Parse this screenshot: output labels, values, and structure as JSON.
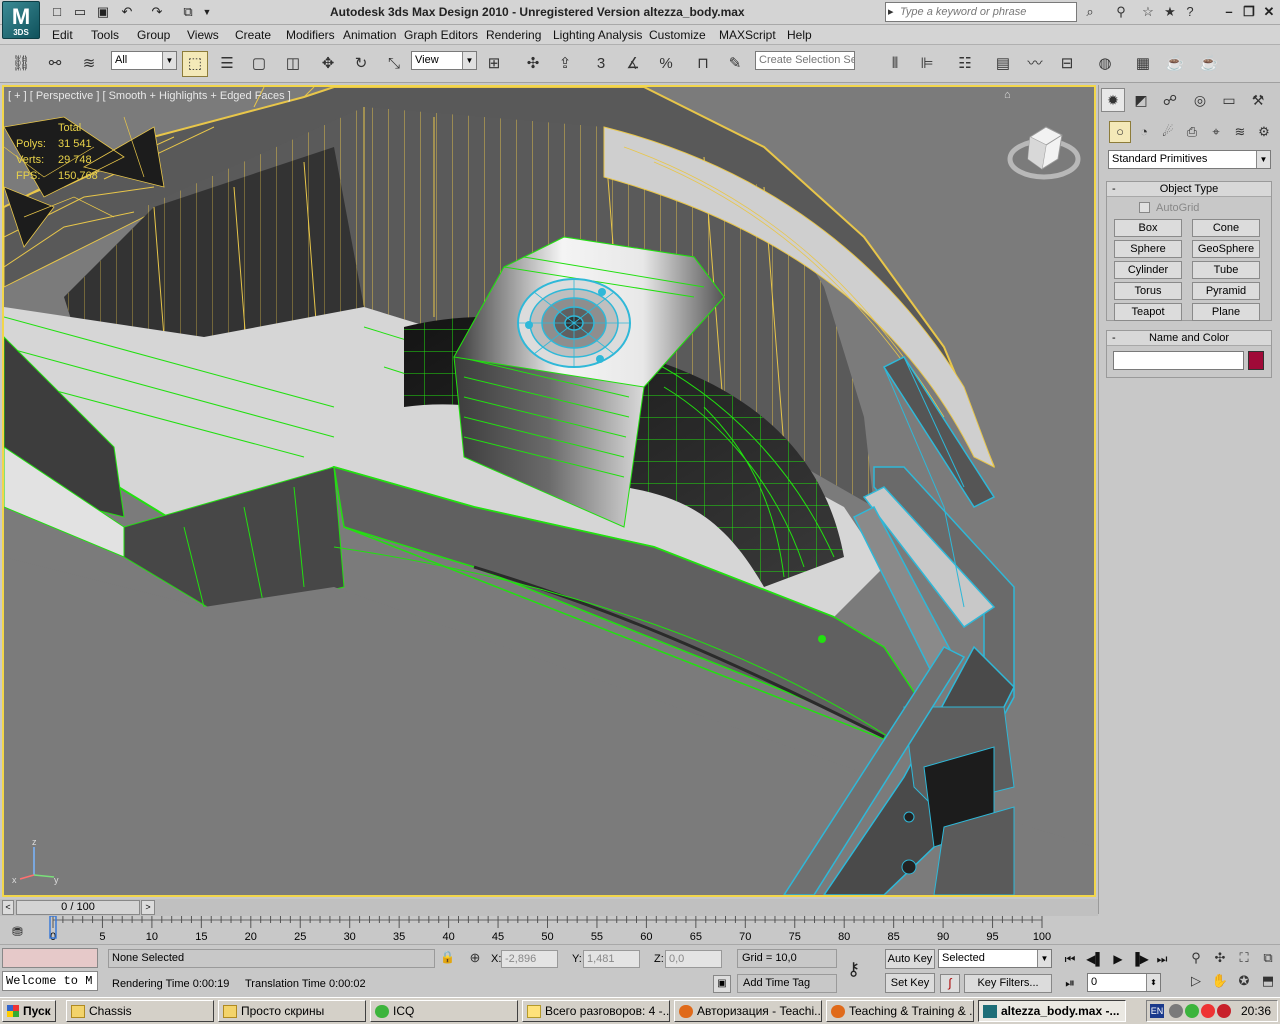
{
  "window": {
    "title": "Autodesk 3ds Max Design 2010  -  Unregistered Version    altezza_body.max",
    "logo_text": "3DS",
    "search_placeholder": "Type a keyword or phrase"
  },
  "menu": [
    "Edit",
    "Tools",
    "Group",
    "Views",
    "Create",
    "Modifiers",
    "Animation",
    "Graph Editors",
    "Rendering",
    "Lighting Analysis",
    "Customize",
    "MAXScript",
    "Help"
  ],
  "toolbar": {
    "selection_filter": "All",
    "reference_coord": "View",
    "snap_angle_label": "3",
    "selection_set_placeholder": "Create Selection Se"
  },
  "viewport": {
    "label": "[ + ] [ Perspective ] [ Smooth + Highlights + Edged Faces ]",
    "stats": {
      "header": "Total",
      "rows": [
        {
          "key": "Polys:",
          "value": "31 541"
        },
        {
          "key": "Verts:",
          "value": "29 748"
        },
        {
          "key": "FPS:",
          "value": "150,768"
        }
      ]
    },
    "colors": {
      "background": "#7b7b7b",
      "frame": "#f2d64a",
      "wire_green": "#22e010",
      "wire_yellow": "#e8c64a",
      "wire_cyan": "#2fb8d8"
    }
  },
  "command_panel": {
    "category": "Standard Primitives",
    "object_type_title": "Object Type",
    "autogrid_label": "AutoGrid",
    "primitives": [
      "Box",
      "Cone",
      "Sphere",
      "GeoSphere",
      "Cylinder",
      "Tube",
      "Torus",
      "Pyramid",
      "Teapot",
      "Plane"
    ],
    "name_color_title": "Name and Color",
    "object_color": "#a00a38"
  },
  "time_slider": {
    "position": "0 / 100",
    "ticks": [
      "0",
      "5",
      "10",
      "15",
      "20",
      "25",
      "30",
      "35",
      "40",
      "45",
      "50",
      "55",
      "60",
      "65",
      "70",
      "75",
      "80",
      "85",
      "90",
      "95",
      "100"
    ]
  },
  "status": {
    "listener_text": "Welcome to M",
    "selection": "None Selected",
    "x_label": "X:",
    "x_value": "-2,896",
    "y_label": "Y:",
    "y_value": "1,481",
    "z_label": "Z:",
    "z_value": "0,0",
    "grid": "Grid = 10,0",
    "rendering_time": "Rendering Time  0:00:19",
    "translation_time": "Translation Time  0:00:02",
    "add_time_tag": "Add Time Tag",
    "auto_key": "Auto Key",
    "set_key": "Set Key",
    "key_mode": "Selected",
    "key_filters": "Key Filters...",
    "current_frame": "0"
  },
  "taskbar": {
    "start": "Пуск",
    "tasks": [
      {
        "label": "Chassis",
        "icon": "folder-icon"
      },
      {
        "label": "Просто скрины",
        "icon": "folder-icon"
      },
      {
        "label": "ICQ",
        "icon": "icq-icon"
      },
      {
        "label": "Всего разговоров: 4 -...",
        "icon": "chat-icon"
      },
      {
        "label": "Авторизация - Teachi...",
        "icon": "firefox-icon"
      },
      {
        "label": "Teaching & Training & ...",
        "icon": "firefox-icon"
      },
      {
        "label": "altezza_body.max -...",
        "icon": "3dsmax-icon"
      }
    ],
    "lang": "EN",
    "clock": "20:36"
  }
}
